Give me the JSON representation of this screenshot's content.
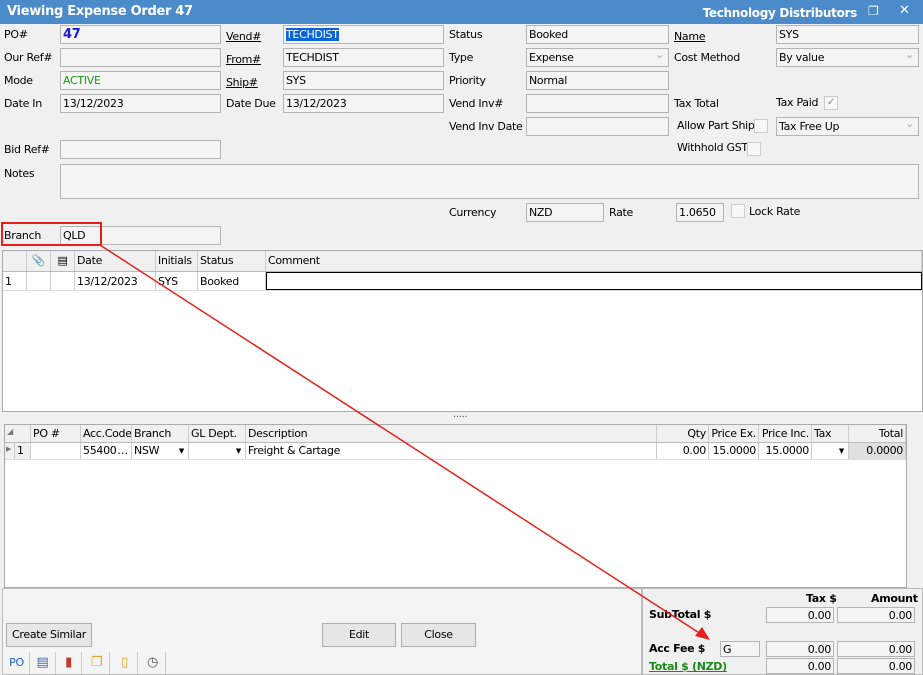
{
  "window": {
    "title": "Viewing Expense Order 47",
    "vendor_title": "Technology Distributors"
  },
  "header": {
    "po_label": "PO#",
    "po_value": "47",
    "our_ref_label": "Our Ref#",
    "our_ref_value": "",
    "mode_label": "Mode",
    "mode_value": "ACTIVE",
    "date_in_label": "Date In",
    "date_in_value": "13/12/2023",
    "bid_ref_label": "Bid Ref#",
    "bid_ref_value": "",
    "notes_label": "Notes",
    "notes_value": "",
    "branch_label": "Branch",
    "branch_value": "QLD",
    "vend_label": "Vend#",
    "vend_value": "TECHDIST",
    "from_label": "From#",
    "from_value": "TECHDIST",
    "ship_label": "Ship#",
    "ship_value": "SYS",
    "date_due_label": "Date Due",
    "date_due_value": "13/12/2023",
    "status_label": "Status",
    "status_value": "Booked",
    "type_label": "Type",
    "type_value": "Expense",
    "priority_label": "Priority",
    "priority_value": "Normal",
    "vend_inv_label": "Vend Inv#",
    "vend_inv_value": "",
    "vend_inv_date_label": "Vend Inv Date",
    "vend_inv_date_value": "",
    "currency_label": "Currency",
    "currency_value": "NZD",
    "rate_label": "Rate",
    "rate_value": "1.0650",
    "lock_rate_label": "Lock Rate",
    "lock_rate_checked": false,
    "name_label": "Name",
    "name_value": "SYS",
    "cost_method_label": "Cost Method",
    "cost_method_value": "By value",
    "tax_total_label": "Tax Total",
    "tax_paid_label": "Tax Paid",
    "tax_paid_checked": true,
    "allow_part_ship_label": "Allow Part Ship",
    "allow_part_ship_checked": false,
    "tax_free_value": "Tax Free Up",
    "withhold_gst_label": "Withhold GST",
    "withhold_gst_checked": false
  },
  "log_grid": {
    "columns": [
      "Date",
      "Initials",
      "Status",
      "Comment"
    ],
    "rows": [
      {
        "num": "1",
        "date": "13/12/2023",
        "initials": "SYS",
        "status": "Booked",
        "comment": ""
      }
    ]
  },
  "splitter": ".....",
  "lines_grid": {
    "columns": [
      "PO #",
      "Acc.Code",
      "Branch",
      "GL Dept.",
      "Description",
      "Qty",
      "Price Ex.",
      "Price Inc.",
      "Tax",
      "Total"
    ],
    "rows": [
      {
        "num": "1",
        "po": "",
        "acc_code": "55400",
        "branch": "NSW",
        "gl_dept": "",
        "description": "Freight & Cartage",
        "qty": "0.00",
        "price_ex": "15.0000",
        "price_inc": "15.0000",
        "tax": "",
        "total": "0.0000"
      }
    ]
  },
  "buttons": {
    "create_similar": "Create Similar",
    "edit": "Edit",
    "close": "Close"
  },
  "bottom_tabs": {
    "po": "PO"
  },
  "totals": {
    "tax_header": "Tax $",
    "amount_header": "Amount",
    "subtotal_label": "SubTotal $",
    "subtotal_tax": "0.00",
    "subtotal_amount": "0.00",
    "acc_fee_label": "Acc Fee $",
    "acc_fee_code": "G",
    "acc_fee_tax": "0.00",
    "acc_fee_amount": "0.00",
    "total_label": "Total $ (NZD)",
    "total_tax": "0.00",
    "total_amount": "0.00"
  },
  "colors": {
    "titlebar": "#4b8bc9",
    "annotation": "#e8201c",
    "active_mode": "#1a9a1a",
    "po_number": "#1a1adc",
    "total_label": "#1a8a1a"
  }
}
